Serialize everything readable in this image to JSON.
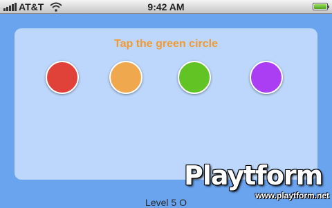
{
  "status_bar": {
    "carrier": "AT&T",
    "time": "9:42 AM",
    "battery_level": 1.0
  },
  "game": {
    "prompt": "Tap the green circle",
    "circles": [
      {
        "name": "red",
        "color": "#e0423a"
      },
      {
        "name": "orange",
        "color": "#f0a84e"
      },
      {
        "name": "green",
        "color": "#62c325"
      },
      {
        "name": "purple",
        "color": "#ab3ef3"
      }
    ],
    "bottom_label": "Level 5 O"
  },
  "watermark": {
    "logo": "Playtform",
    "url": "www.playtform.net"
  },
  "colors": {
    "background": "#6aa4ee",
    "panel": "#bcd7fb",
    "prompt_text": "#f09a30"
  }
}
